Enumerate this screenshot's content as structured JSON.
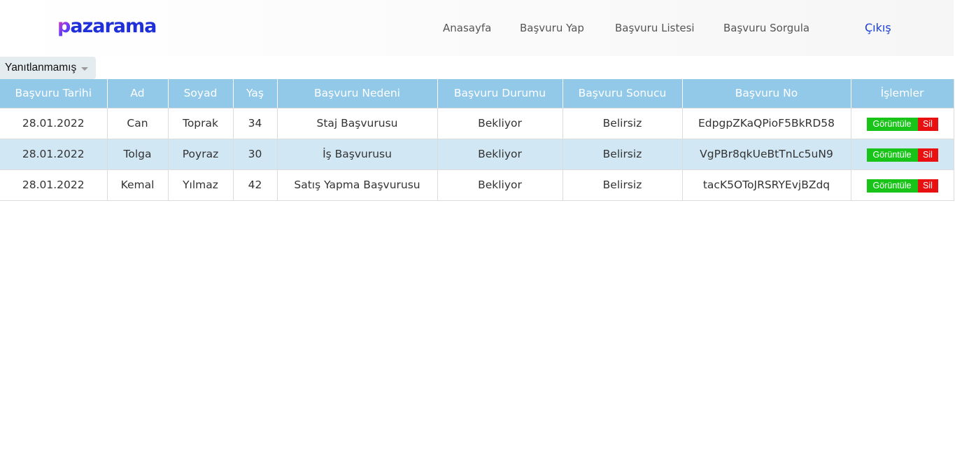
{
  "brand": {
    "logo_first": "p",
    "logo_rest": "azarama",
    "logo_color": "#2030d8"
  },
  "nav": {
    "home": "Anasayfa",
    "apply": "Başvuru Yap",
    "list": "Başvuru Listesi",
    "query": "Başvuru Sorgula",
    "logout": "Çıkış"
  },
  "filter": {
    "selected": "Yanıtlanmamış"
  },
  "table": {
    "headers": [
      "Başvuru Tarihi",
      "Ad",
      "Soyad",
      "Yaş",
      "Başvuru Nedeni",
      "Başvuru Durumu",
      "Başvuru Sonucu",
      "Başvuru No",
      "İşlemler"
    ],
    "rows": [
      {
        "date": "28.01.2022",
        "first": "Can",
        "last": "Toprak",
        "age": "34",
        "reason": "Staj Başvurusu",
        "status": "Bekliyor",
        "result": "Belirsiz",
        "no": "EdpgpZKaQPioF5BkRD58",
        "view": "Görüntüle",
        "del": "Sil"
      },
      {
        "date": "28.01.2022",
        "first": "Tolga",
        "last": "Poyraz",
        "age": "30",
        "reason": "İş Başvurusu",
        "status": "Bekliyor",
        "result": "Belirsiz",
        "no": "VgPBr8qkUeBtTnLc5uN9",
        "view": "Görüntüle",
        "del": "Sil"
      },
      {
        "date": "28.01.2022",
        "first": "Kemal",
        "last": "Yılmaz",
        "age": "42",
        "reason": "Satış Yapma Başvurusu",
        "status": "Bekliyor",
        "result": "Belirsiz",
        "no": "tacK5OToJRSRYEvjBZdq",
        "view": "Görüntüle",
        "del": "Sil"
      }
    ]
  },
  "colors": {
    "header_bg": "#92c9e9",
    "alt_row_bg": "#d2e7f4",
    "view_button": "#17c417",
    "delete_button": "#e81010",
    "logout_link": "#1a3fd6"
  },
  "icons": {
    "filter_dropdown": "caret-down-icon"
  }
}
